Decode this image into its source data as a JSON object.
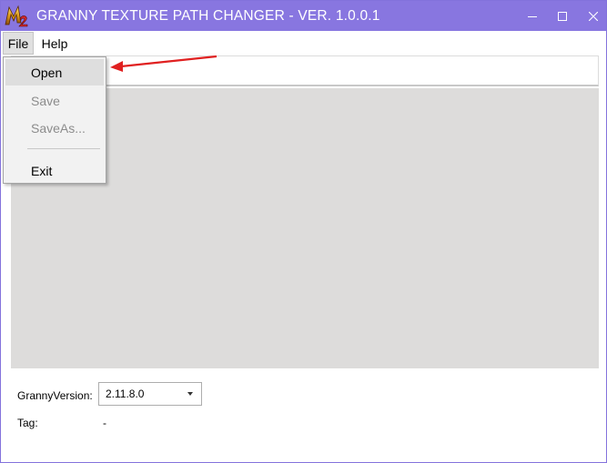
{
  "window": {
    "title": "GRANNY TEXTURE PATH CHANGER - VER. 1.0.0.1",
    "logo_icon": "m2-logo-icon",
    "titlebar_color": "#8876e0"
  },
  "menubar": {
    "items": [
      {
        "label": "File",
        "active": true
      },
      {
        "label": "Help",
        "active": false
      }
    ]
  },
  "file_menu": {
    "items": [
      {
        "label": "Open",
        "enabled": true,
        "highlighted": true
      },
      {
        "label": "Save",
        "enabled": false
      },
      {
        "label": "SaveAs...",
        "enabled": false
      },
      {
        "label": "Exit",
        "enabled": true
      }
    ]
  },
  "form": {
    "granny_version_label": "GrannyVersion:",
    "granny_version_value": "2.11.8.0",
    "tag_label": "Tag:",
    "tag_value": "-"
  },
  "annotation": {
    "arrow_color": "#e02020"
  }
}
